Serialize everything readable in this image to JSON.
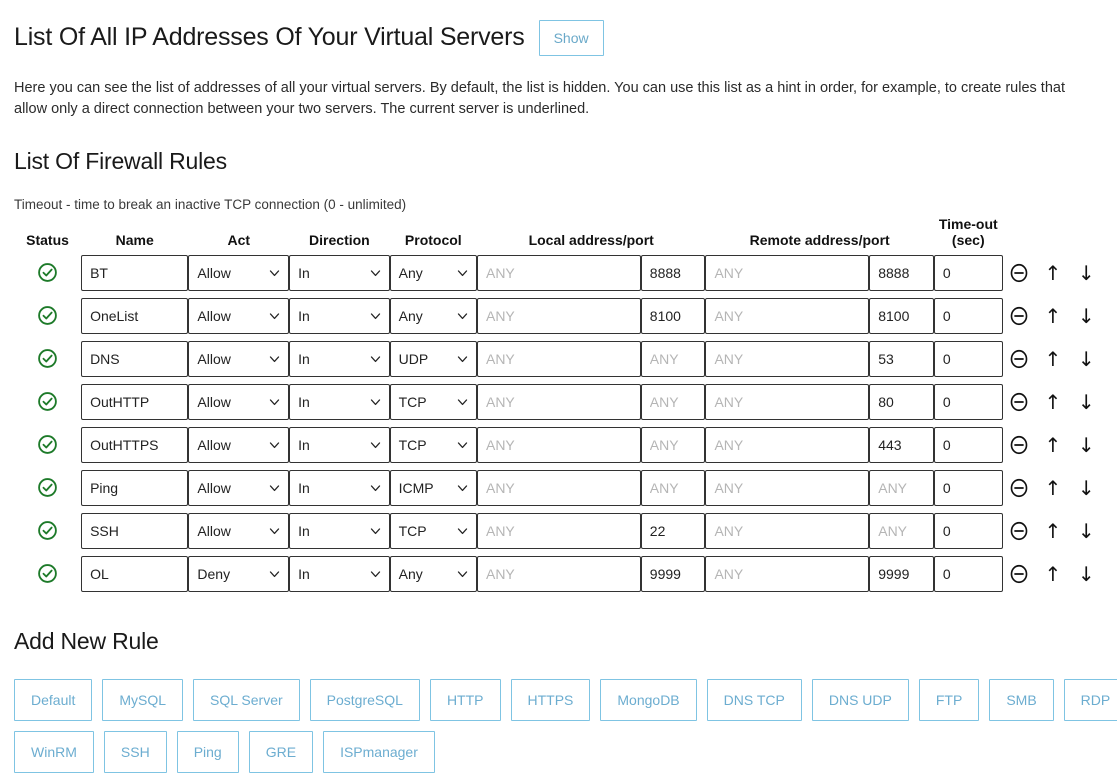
{
  "ip_section": {
    "title": "List Of All IP Addresses Of Your Virtual Servers",
    "show_button": "Show",
    "description": "Here you can see the list of addresses of all your virtual servers. By default, the list is hidden. You can use this list as a hint in order, for example, to create rules that allow only a direct connection between your two servers. The current server is underlined."
  },
  "firewall_section": {
    "title": "List Of Firewall Rules",
    "timeout_note": "Timeout - time to break an inactive TCP connection (0 - unlimited)",
    "headers": {
      "status": "Status",
      "name": "Name",
      "act": "Act",
      "direction": "Direction",
      "protocol": "Protocol",
      "local": "Local address/port",
      "remote": "Remote address/port",
      "timeout_line1": "Time-out",
      "timeout_line2": "(sec)"
    },
    "placeholders": {
      "address": "ANY",
      "port": "ANY"
    },
    "icons": {
      "status": "check-circle-icon",
      "remove": "minus-circle-icon",
      "move_up": "arrow-up-icon",
      "move_down": "arrow-down-icon"
    },
    "status_color": "#1d7a29",
    "rows": [
      {
        "status": "enabled",
        "name": "BT",
        "act": "Allow",
        "direction": "In",
        "protocol": "Any",
        "local_addr": "",
        "local_port": "8888",
        "remote_addr": "",
        "remote_port": "8888",
        "timeout": "0"
      },
      {
        "status": "enabled",
        "name": "OneList",
        "act": "Allow",
        "direction": "In",
        "protocol": "Any",
        "local_addr": "",
        "local_port": "8100",
        "remote_addr": "",
        "remote_port": "8100",
        "timeout": "0"
      },
      {
        "status": "enabled",
        "name": "DNS",
        "act": "Allow",
        "direction": "In",
        "protocol": "UDP",
        "local_addr": "",
        "local_port": "",
        "remote_addr": "",
        "remote_port": "53",
        "timeout": "0"
      },
      {
        "status": "enabled",
        "name": "OutHTTP",
        "act": "Allow",
        "direction": "In",
        "protocol": "TCP",
        "local_addr": "",
        "local_port": "",
        "remote_addr": "",
        "remote_port": "80",
        "timeout": "0"
      },
      {
        "status": "enabled",
        "name": "OutHTTPS",
        "act": "Allow",
        "direction": "In",
        "protocol": "TCP",
        "local_addr": "",
        "local_port": "",
        "remote_addr": "",
        "remote_port": "443",
        "timeout": "0"
      },
      {
        "status": "enabled",
        "name": "Ping",
        "act": "Allow",
        "direction": "In",
        "protocol": "ICMP",
        "local_addr": "",
        "local_port": "",
        "remote_addr": "",
        "remote_port": "",
        "timeout": "0"
      },
      {
        "status": "enabled",
        "name": "SSH",
        "act": "Allow",
        "direction": "In",
        "protocol": "TCP",
        "local_addr": "",
        "local_port": "22",
        "remote_addr": "",
        "remote_port": "",
        "timeout": "0"
      },
      {
        "status": "enabled",
        "name": "OL",
        "act": "Deny",
        "direction": "In",
        "protocol": "Any",
        "local_addr": "",
        "local_port": "9999",
        "remote_addr": "",
        "remote_port": "9999",
        "timeout": "0"
      }
    ]
  },
  "add_new_rule": {
    "title": "Add New Rule",
    "accent_color": "#7fc4e3",
    "preset_rows": [
      [
        "Default",
        "MySQL",
        "SQL Server",
        "PostgreSQL",
        "HTTP",
        "HTTPS",
        "MongoDB",
        "DNS TCP",
        "DNS UDP",
        "FTP",
        "SMB",
        "RDP"
      ],
      [
        "WinRM",
        "SSH",
        "Ping",
        "GRE",
        "ISPmanager"
      ]
    ]
  }
}
